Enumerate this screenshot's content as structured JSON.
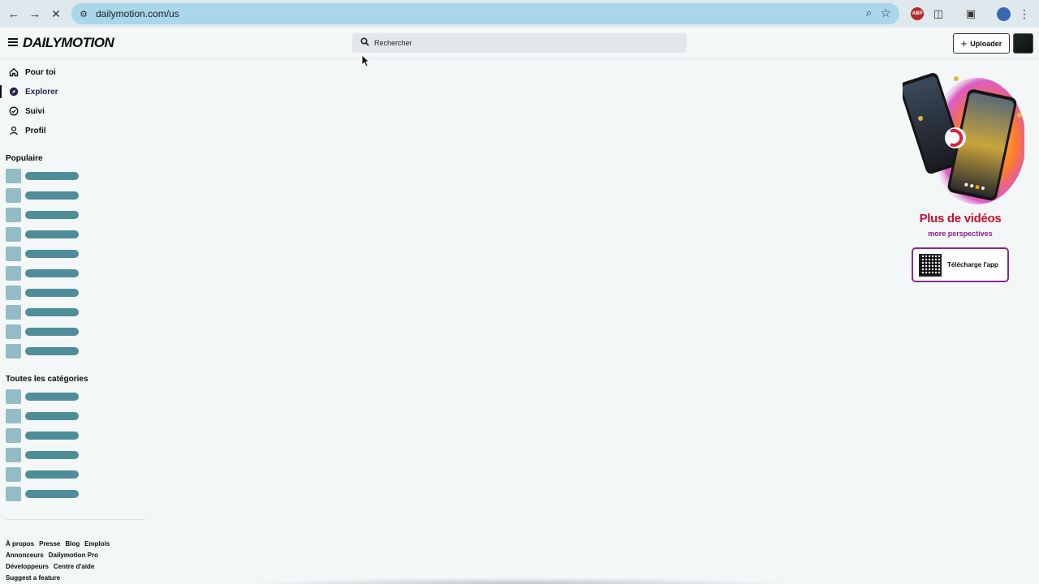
{
  "browser": {
    "url": "dailymotion.com/us",
    "icons": [
      "back-arrow-icon",
      "forward-arrow-icon",
      "stop-loading-icon",
      "site-settings-icon",
      "zoom-icon",
      "bookmark-star-icon",
      "adblock-icon",
      "extensions-icon",
      "cast-icon",
      "profile-icon",
      "menu-icon"
    ],
    "adblock_label": "ABP"
  },
  "header": {
    "logo": "DAILYMOTION",
    "search_placeholder": "Rechercher",
    "upload_label": "Uploader"
  },
  "sidebar": {
    "nav": [
      {
        "label": "Pour toi",
        "icon": "home-icon"
      },
      {
        "label": "Explorer",
        "icon": "compass-icon",
        "active": true
      },
      {
        "label": "Suivi",
        "icon": "check-circle-icon"
      },
      {
        "label": "Profil",
        "icon": "person-icon"
      }
    ],
    "popular_title": "Populaire",
    "popular_placeholders": 10,
    "categories_title": "Toutes les catégories",
    "categories_placeholders": 6,
    "footer": [
      "À propos",
      "Presse",
      "Blog",
      "Emplois",
      "Annonceurs",
      "Dailymotion Pro",
      "Développeurs",
      "Centre d'aide",
      "Suggest a feature"
    ]
  },
  "promo": {
    "title": "Plus de vidéos",
    "subtitle": "more perspectives",
    "button_label": "Télécharge l'app",
    "colors": {
      "title": "#c4102b",
      "subtitle": "#8e1d8a",
      "border": "#8a2b84"
    }
  }
}
